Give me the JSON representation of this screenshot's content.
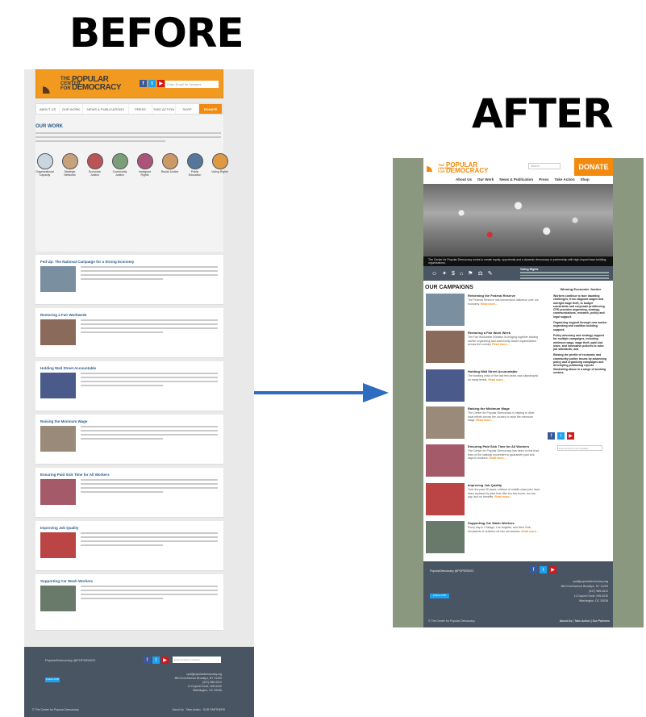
{
  "labels": {
    "before": "BEFORE",
    "after": "AFTER"
  },
  "before": {
    "logo_line1": "THE CENTER FOR",
    "logo_line2": "POPULAR DEMOCRACY",
    "email_placeholder": "Enter Email for Updates",
    "nav": [
      "ABOUT US",
      "OUR WORK",
      "NEWS & PUBLICATIONS",
      "PRESS",
      "TAKE ACTION",
      "SHOP",
      "DONATE"
    ],
    "our_work": "OUR WORK",
    "issues": [
      "Organizational Capacity",
      "Strategic Networks",
      "Economic Justice",
      "Community Justice",
      "Immigrant Rights",
      "Racial Justice",
      "Public Education",
      "Voting Rights"
    ],
    "cards": [
      "Fed Up: The National Campaign for a Strong Economy",
      "Restoring a Fair Workweek",
      "Holding Wall Street Accountable",
      "Raising the Minimum Wage",
      "Ensuring Paid Sick Time for All Workers",
      "Improving Job Quality",
      "Supporting Car Wash Workers"
    ],
    "footer_handle": "PopularDemocracy @POPDEMOC",
    "follow": "Follow CPD",
    "address": [
      "cpd@populardemocracy.org",
      "860 Kent Avenue Brooklyn, NY 11205",
      "(347) 985-2612",
      "11 Dupont Circle, NW #240",
      "Washington, DC 20036"
    ],
    "copyright": "© The Center for Popular Democracy",
    "links": [
      "About Us",
      "Take Action",
      "OUR PARTNERS"
    ]
  },
  "after": {
    "logo_line1": "THE CENTER FOR",
    "logo_line2": "POPULAR DEMOCRACY",
    "search": "Search",
    "donate": "DONATE",
    "nav": [
      "About Us",
      "Our Work",
      "News & Publication",
      "Press",
      "Take Action",
      "Shop"
    ],
    "caption": "The Center for Popular Democracy works to create equity, opportunity and a dynamic democracy in partnership with high-impact base-building organizations.",
    "voting_rights": "Voting Rights",
    "campaigns_title": "OUR CAMPAIGNS",
    "items": [
      {
        "title": "Reforming the Federal Reserve",
        "text": "The Federal Reserve has tremendous influence over our economy.",
        "more": "Read more..."
      },
      {
        "title": "Restoring a Fair Work Week",
        "text": "The Fair Workweek Initiative is bringing together leading worker-organizing and community-based organizations across the country.",
        "more": "Read more..."
      },
      {
        "title": "Holding Wall Street Accountable",
        "text": "The banking crisis of the last few years was catastrophic on many levels.",
        "more": "Read more..."
      },
      {
        "title": "Raising the Minimum Wage",
        "text": "The Center for Popular Democracy is helping to drive local efforts across the country to raise the minimum wage.",
        "more": "Read more..."
      },
      {
        "title": "Ensuring Paid Sick Time for All Workers",
        "text": "The Center for Popular Democracy has been on the front lines of the national movement to guarantee paid sick days to workers.",
        "more": "Read more..."
      },
      {
        "title": "Improving Job Quality",
        "text": "Over the past 40 years, millions of middle-class jobs have been replaced by jobs that offer too few hours, too low pay, and no benefits.",
        "more": "Read more..."
      },
      {
        "title": "Supporting Car Wash Workers",
        "text": "Every day in Chicago, Los Angeles, and New York, thousands of vehicles roll into car washes.",
        "more": "Read more..."
      }
    ],
    "side_title": "Winning Economic Justice",
    "side_paras": [
      "Workers continue to face daunting challenges, from stagnant wages and outright wage theft, to budget constraints and corporate profiteering. CPD provides organizing, strategy, communications, research, policy and legal support.",
      "Organizing support through new worker organizing and coalition building support;",
      "Policy advocacy and strategy support for multiple campaigns, including minimum wage, wage theft, paid sick leave, and innovative policies to raise job standards; and",
      "Raising the profile of economic and community justice issues by advancing policy and organizing campaigns and developing publishing reports illustrating abuse in a range of working sectors."
    ],
    "side_email": "Enter Email to Get Updates",
    "footer_handle": "PopularDemocracy @POPDEMOC",
    "follow": "Follow CPD",
    "address": [
      "cpd@populardemocracy.org",
      "860 Kent Avenue Brooklyn, NY 11205",
      "(347) 985-2612",
      "11 Dupont Circle, NW #240",
      "Washington, DC 20036"
    ],
    "copyright": "© The Center for Popular Democracy",
    "links": [
      "About Us",
      "Take Action",
      "Our Partners"
    ]
  },
  "colors": {
    "orange": "#f28a10",
    "navy": "#4a5563",
    "arrow": "#2d6cbf",
    "sage": "#8a9880"
  }
}
